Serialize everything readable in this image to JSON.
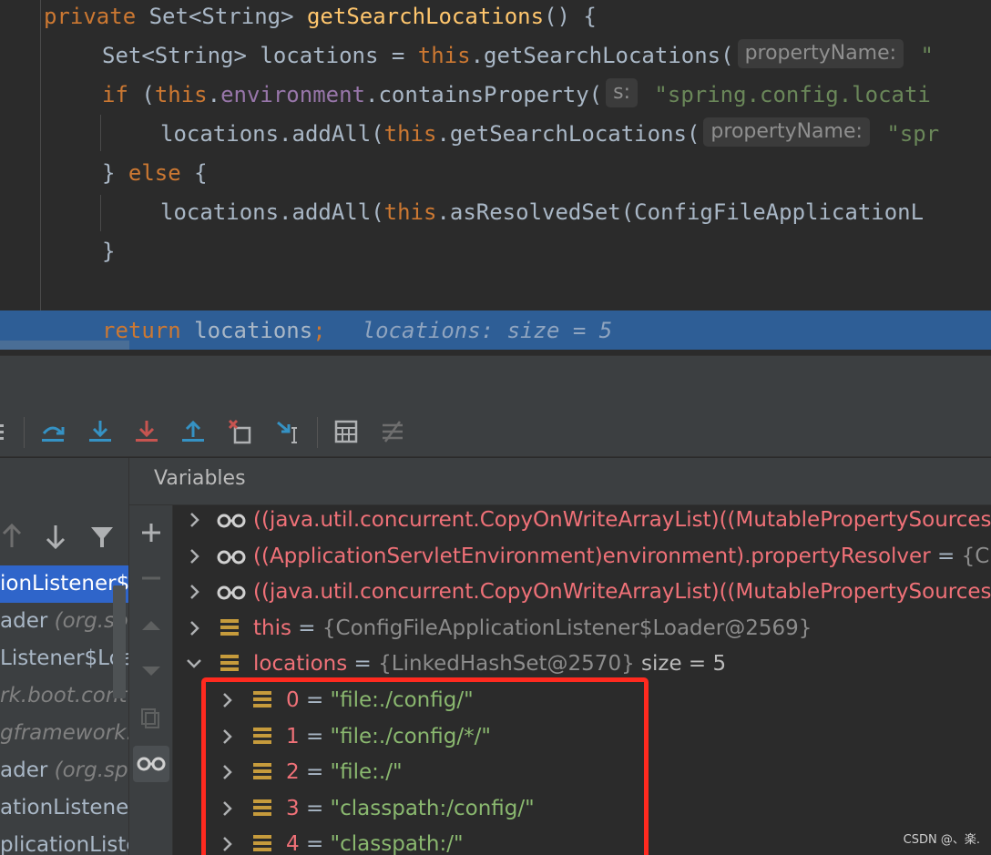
{
  "editor": {
    "lines": [
      {
        "id": "l1",
        "tokens": [
          [
            "kw",
            "private "
          ],
          [
            "",
            "Set<String> "
          ],
          [
            "fn",
            "getSearchLocations"
          ],
          [
            "",
            "() {"
          ]
        ]
      },
      {
        "id": "l2",
        "tokens": [
          [
            "",
            "Set<String> locations = "
          ],
          [
            "kw",
            "this"
          ],
          [
            "",
            ".getSearchLocations("
          ]
        ],
        "hint": "propertyName:",
        "tail": [
          [
            "str",
            " \""
          ]
        ]
      },
      {
        "id": "l3",
        "tokens": [
          [
            "kw",
            "if "
          ],
          [
            "",
            "("
          ],
          [
            "kw",
            "this"
          ],
          [
            "",
            "."
          ],
          [
            "fld",
            "environment"
          ],
          [
            "",
            ".containsProperty("
          ]
        ],
        "hint": "s:",
        "tail": [
          [
            "str",
            " \"spring.config.locati"
          ]
        ]
      },
      {
        "id": "l4",
        "tokens": [
          [
            "",
            "locations.addAll("
          ],
          [
            "kw",
            "this"
          ],
          [
            "",
            ".getSearchLocations("
          ]
        ],
        "hint": "propertyName:",
        "tail": [
          [
            "str",
            " \"spr"
          ]
        ]
      },
      {
        "id": "l5",
        "tokens": [
          [
            "",
            "} "
          ],
          [
            "kw",
            "else "
          ],
          [
            "",
            "{"
          ]
        ]
      },
      {
        "id": "l6",
        "tokens": [
          [
            "",
            "locations.addAll("
          ],
          [
            "kw",
            "this"
          ],
          [
            "",
            ".asResolvedSet(ConfigFileApplicationL"
          ]
        ]
      },
      {
        "id": "l7",
        "tokens": [
          [
            "",
            "}"
          ]
        ]
      },
      {
        "id": "l8",
        "tokens": [
          [
            "kw",
            "return "
          ],
          [
            "",
            "locations"
          ],
          [
            "kw",
            ";"
          ]
        ],
        "inline": "locations:  size = 5"
      }
    ]
  },
  "toolbar": {
    "buttons": [
      {
        "name": "step-over-icon",
        "color": "#3592c4"
      },
      {
        "name": "step-into-icon",
        "color": "#3592c4"
      },
      {
        "name": "force-step-into-icon",
        "color": "#c75450"
      },
      {
        "name": "step-out-icon",
        "color": "#3592c4"
      },
      {
        "name": "drop-frame-icon",
        "color": "#c75450"
      },
      {
        "name": "run-to-cursor-icon",
        "color": "#3592c4"
      },
      {
        "name": "evaluate-expression-icon",
        "color": "#afb1b3"
      },
      {
        "name": "trace-current-stream-icon",
        "color": "#6e6e6e"
      }
    ]
  },
  "frames": {
    "items": [
      {
        "text": "ionListener$",
        "pkg": "",
        "selected": true
      },
      {
        "text": "ader ",
        "pkg": "(org.spr",
        "selected": false
      },
      {
        "text": "Listener$Loa",
        "pkg": "",
        "selected": false
      },
      {
        "text": "",
        "pkg": "rk.boot.cont",
        "selected": false
      },
      {
        "text": "",
        "pkg": "gframework.",
        "selected": false
      },
      {
        "text": "ader ",
        "pkg": "(org.spr",
        "selected": false
      },
      {
        "text": "ationListener",
        "pkg": "",
        "selected": false
      },
      {
        "text": "plicationListe",
        "pkg": "",
        "selected": false
      }
    ]
  },
  "variables": {
    "title": "Variables",
    "rows": [
      {
        "icon": "watch-icon",
        "name": "((java.util.concurrent.CopyOnWriteArrayList)((MutablePropertySources)(",
        "eq": "",
        "value": "",
        "vtype": "ref",
        "extra": "",
        "level": 0,
        "expanded": false
      },
      {
        "icon": "watch-icon",
        "name": "((ApplicationServletEnvironment)environment).propertyResolver",
        "eq": " = ",
        "value": "{Clas",
        "vtype": "ref",
        "extra": "",
        "level": 0,
        "expanded": false
      },
      {
        "icon": "watch-icon",
        "name": "((java.util.concurrent.CopyOnWriteArrayList)((MutablePropertySources)(",
        "eq": "",
        "value": "",
        "vtype": "ref",
        "extra": "",
        "level": 0,
        "expanded": false
      },
      {
        "icon": "field-icon",
        "name": "this",
        "eq": " = ",
        "value": "{ConfigFileApplicationListener$Loader@2569}",
        "vtype": "ref",
        "extra": "",
        "level": 0,
        "expanded": false
      },
      {
        "icon": "field-icon",
        "name": "locations",
        "eq": " = ",
        "value": "{LinkedHashSet@2570}",
        "vtype": "ref",
        "extra": "  size = 5",
        "level": 0,
        "expanded": true
      },
      {
        "icon": "field-icon",
        "name": "0",
        "eq": " = ",
        "value": "\"file:./config/\"",
        "vtype": "str",
        "extra": "",
        "level": 1,
        "expanded": false
      },
      {
        "icon": "field-icon",
        "name": "1",
        "eq": " = ",
        "value": "\"file:./config/*/\"",
        "vtype": "str",
        "extra": "",
        "level": 1,
        "expanded": false
      },
      {
        "icon": "field-icon",
        "name": "2",
        "eq": " = ",
        "value": "\"file:./\"",
        "vtype": "str",
        "extra": "",
        "level": 1,
        "expanded": false
      },
      {
        "icon": "field-icon",
        "name": "3",
        "eq": " = ",
        "value": "\"classpath:/config/\"",
        "vtype": "str",
        "extra": "",
        "level": 1,
        "expanded": false
      },
      {
        "icon": "field-icon",
        "name": "4",
        "eq": " = ",
        "value": "\"classpath:/\"",
        "vtype": "str",
        "extra": "",
        "level": 1,
        "expanded": false
      }
    ]
  },
  "watermark": "CSDN @、楽.",
  "colors": {
    "highlight": "#ff2a1f",
    "selection": "#2f65ca",
    "exec_line": "#2e5e96"
  }
}
